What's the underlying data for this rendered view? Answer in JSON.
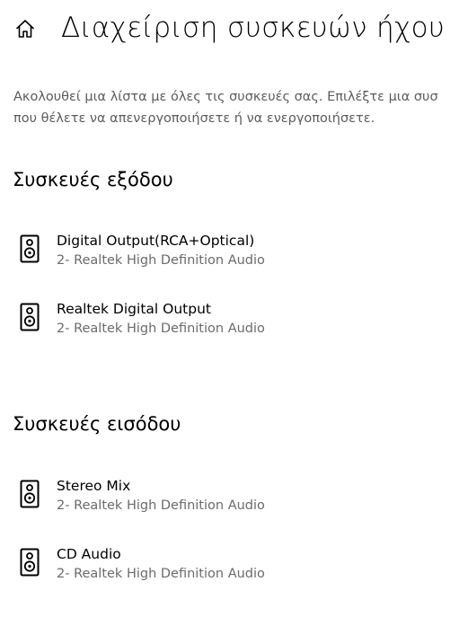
{
  "header": {
    "title": "Διαχείριση συσκευών ήχου",
    "home_icon": "home-icon"
  },
  "description": {
    "line1": "Ακολουθεί μια λίστα με όλες τις συσκευές σας. Επιλέξτε μια συσ",
    "line2": "που θέλετε να απενεργοποιήσετε ή να ενεργοποιήσετε."
  },
  "output_section": {
    "heading": "Συσκευές εξόδου",
    "devices": [
      {
        "name": "Digital Output(RCA+Optical)",
        "subtitle": "2- Realtek High Definition Audio",
        "icon": "speaker-icon"
      },
      {
        "name": "Realtek Digital Output",
        "subtitle": "2- Realtek High Definition Audio",
        "icon": "speaker-icon"
      }
    ]
  },
  "input_section": {
    "heading": "Συσκευές εισόδου",
    "devices": [
      {
        "name": "Stereo Mix",
        "subtitle": "2- Realtek High Definition Audio",
        "icon": "speaker-icon"
      },
      {
        "name": "CD Audio",
        "subtitle": "2- Realtek High Definition Audio",
        "icon": "speaker-icon"
      }
    ]
  },
  "colors": {
    "background": "#ffffff",
    "text": "#000000",
    "secondary_text": "#6b6b6b"
  }
}
